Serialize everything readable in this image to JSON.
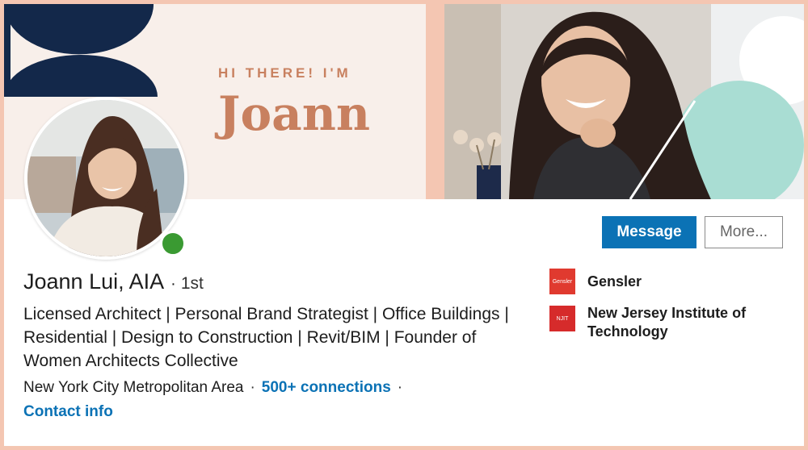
{
  "banner": {
    "greeting": "HI THERE! I'M",
    "name": "Joann"
  },
  "profile": {
    "name": "Joann Lui, AIA",
    "separator": "·",
    "degree": "1st",
    "headline": "Licensed Architect | Personal Brand Strategist | Office Buildings | Residential | Design to Construction | Revit/BIM | Founder of Women Architects Collective",
    "location": "New York City Metropolitan Area",
    "connections": "500+ connections",
    "contact_label": "Contact info",
    "online_status": "online"
  },
  "actions": {
    "message_label": "Message",
    "more_label": "More..."
  },
  "experience": [
    {
      "name": "Gensler",
      "logo_text": "Gensler",
      "logo_icon": "gensler-logo"
    },
    {
      "name": "New Jersey Institute of Technology",
      "logo_text": "NJIT",
      "logo_icon": "njit-logo"
    }
  ],
  "colors": {
    "accent": "#0b72b5",
    "online": "#3a9a32",
    "banner_text": "#c8805f",
    "banner_navy": "#13284a",
    "banner_mint": "#a9ddd3",
    "frame": "#f4c6b2"
  }
}
